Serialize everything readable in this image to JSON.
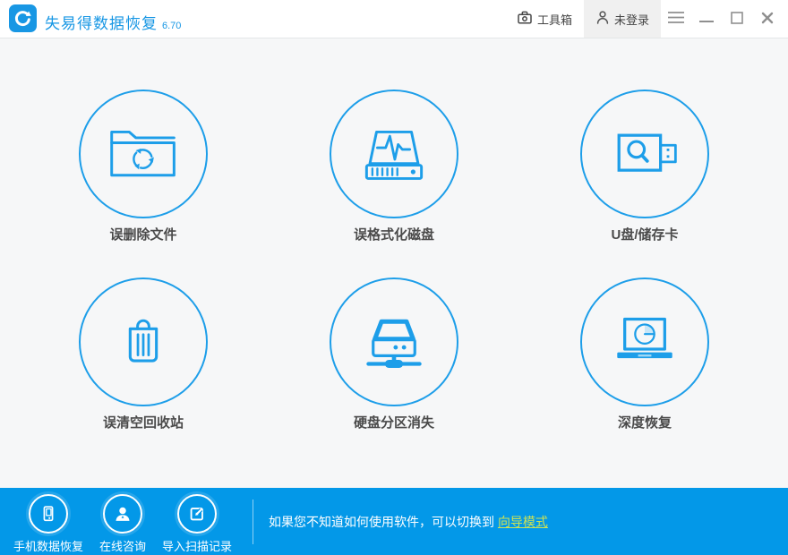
{
  "colors": {
    "brand_blue": "#1897e4",
    "circle_blue": "#1d9ee9",
    "footer_blue": "#0398e8",
    "link_yellow": "#cde254",
    "label_gray": "#4a4a4a"
  },
  "topbar": {
    "logo_icon": "refresh-arrow-logo-icon",
    "title": "失易得数据恢复",
    "version": "6.70",
    "toolbox_label": "工具箱",
    "toolbox_icon": "toolbox-icon",
    "login_label": "未登录",
    "login_icon": "user-icon",
    "window_controls": {
      "menu": "menu-icon",
      "minimize": "minimize-icon",
      "maximize": "maximize-icon",
      "close": "close-icon"
    }
  },
  "main": {
    "tiles": [
      {
        "label": "误删除文件",
        "icon": "folder-recycle-icon"
      },
      {
        "label": "误格式化磁盘",
        "icon": "disk-waveform-icon"
      },
      {
        "label": "U盘/储存卡",
        "icon": "usb-search-icon"
      },
      {
        "label": "误清空回收站",
        "icon": "trash-icon"
      },
      {
        "label": "硬盘分区消失",
        "icon": "drive-network-icon"
      },
      {
        "label": "深度恢复",
        "icon": "laptop-pie-icon"
      }
    ]
  },
  "footer": {
    "items": [
      {
        "label": "手机数据恢复",
        "icon": "phone-icon"
      },
      {
        "label": "在线咨询",
        "icon": "person-icon"
      },
      {
        "label": "导入扫描记录",
        "icon": "import-icon"
      }
    ],
    "hint_text": "如果您不知道如何使用软件，可以切换到 ",
    "hint_link": "向导模式"
  }
}
